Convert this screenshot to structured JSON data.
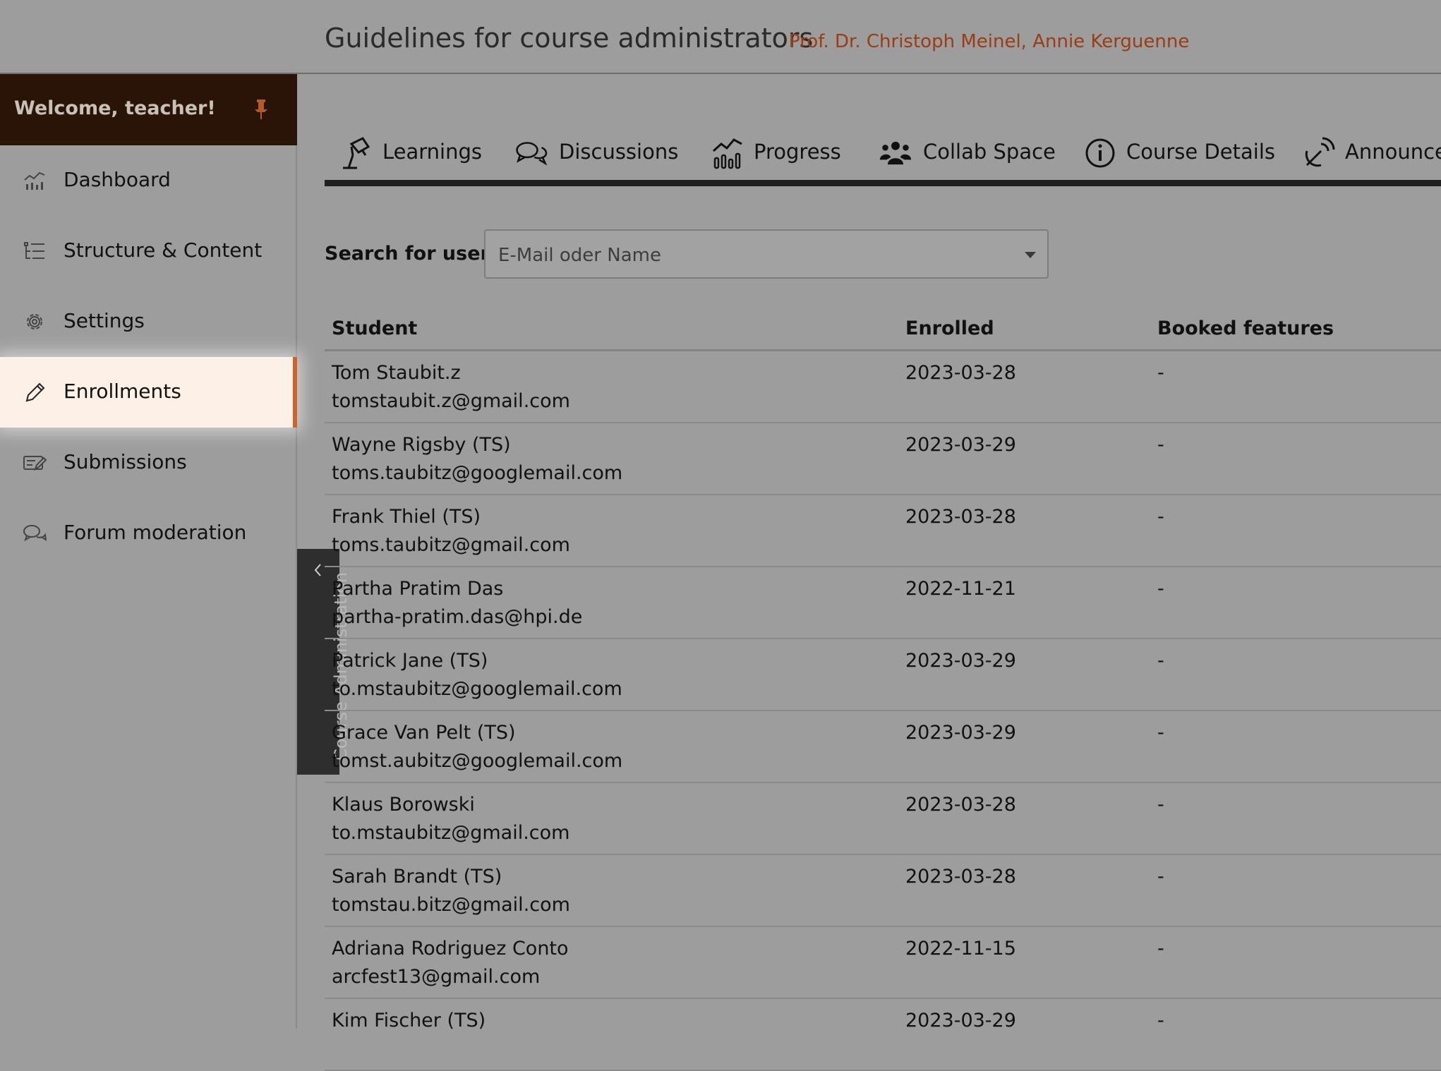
{
  "header": {
    "course_title": "Guidelines for course administrators",
    "authors": "Prof. Dr. Christoph Meinel, Annie Kerguenne"
  },
  "sidebar": {
    "welcome": "Welcome, teacher!",
    "items": [
      {
        "label": "Dashboard",
        "icon": "dashboard-chart-icon"
      },
      {
        "label": "Structure & Content",
        "icon": "structure-list-icon"
      },
      {
        "label": "Settings",
        "icon": "gear-icon"
      },
      {
        "label": "Enrollments",
        "icon": "pencil-icon",
        "active": true
      },
      {
        "label": "Submissions",
        "icon": "submissions-icon"
      },
      {
        "label": "Forum moderation",
        "icon": "chat-bubbles-icon"
      }
    ],
    "collapse_label": "Course Administration"
  },
  "tabs": [
    {
      "label": "Learnings",
      "icon": "lamp-icon"
    },
    {
      "label": "Discussions",
      "icon": "discussions-icon"
    },
    {
      "label": "Progress",
      "icon": "progress-chart-icon"
    },
    {
      "label": "Collab Space",
      "icon": "group-icon"
    },
    {
      "label": "Course Details",
      "icon": "info-icon"
    },
    {
      "label": "Announcements",
      "icon": "satellite-icon"
    }
  ],
  "search": {
    "label": "Search for user",
    "placeholder": "E-Mail oder Name"
  },
  "table": {
    "columns": [
      "Student",
      "Enrolled",
      "Booked features"
    ],
    "rows": [
      {
        "name": "Tom Staubit.z",
        "email": "tomstaubit.z@gmail.com",
        "enrolled": "2023-03-28",
        "booked": "-"
      },
      {
        "name": "Wayne Rigsby (TS)",
        "email": "toms.taubitz@googlemail.com",
        "enrolled": "2023-03-29",
        "booked": "-"
      },
      {
        "name": "Frank Thiel (TS)",
        "email": "toms.taubitz@gmail.com",
        "enrolled": "2023-03-28",
        "booked": "-"
      },
      {
        "name": "Partha Pratim Das",
        "email": "partha-pratim.das@hpi.de",
        "enrolled": "2022-11-21",
        "booked": "-"
      },
      {
        "name": "Patrick Jane (TS)",
        "email": "to.mstaubitz@googlemail.com",
        "enrolled": "2023-03-29",
        "booked": "-"
      },
      {
        "name": "Grace Van Pelt (TS)",
        "email": "tomst.aubitz@googlemail.com",
        "enrolled": "2023-03-29",
        "booked": "-"
      },
      {
        "name": "Klaus Borowski",
        "email": "to.mstaubitz@gmail.com",
        "enrolled": "2023-03-28",
        "booked": "-"
      },
      {
        "name": "Sarah Brandt (TS)",
        "email": "tomstau.bitz@gmail.com",
        "enrolled": "2023-03-28",
        "booked": "-"
      },
      {
        "name": "Adriana Rodriguez Conto",
        "email": "arcfest13@gmail.com",
        "enrolled": "2022-11-15",
        "booked": "-"
      },
      {
        "name": "Kim Fischer (TS)",
        "email": "",
        "enrolled": "2023-03-29",
        "booked": "-"
      }
    ]
  },
  "colors": {
    "accent": "#d0632a",
    "author_text": "#9b3d12",
    "welcome_bg": "#2a1408",
    "active_bg": "#fdf0e6",
    "page_bg": "#9d9d9d"
  }
}
